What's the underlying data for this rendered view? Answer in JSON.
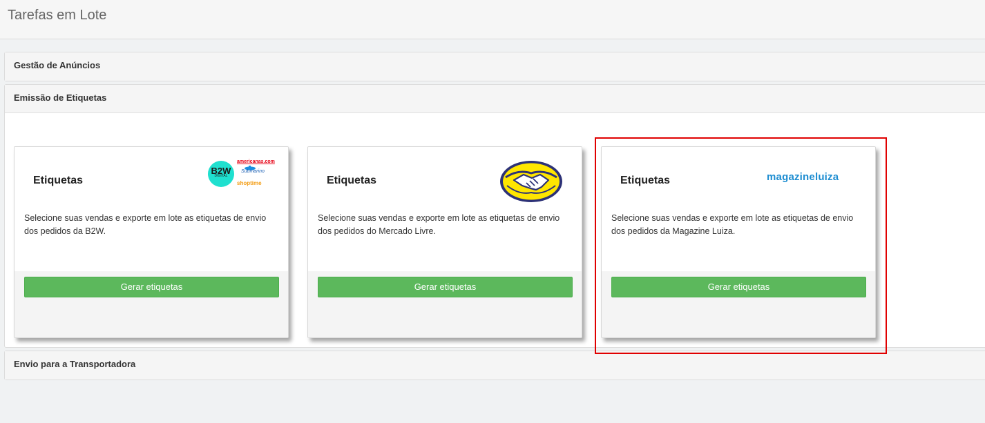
{
  "page": {
    "title": "Tarefas em Lote"
  },
  "panels": {
    "gestao": {
      "heading": "Gestão de Anúncios"
    },
    "emissao": {
      "heading": "Emissão de Etiquetas"
    },
    "envio": {
      "heading": "Envio para a Transportadora"
    }
  },
  "cards": [
    {
      "title": "Etiquetas",
      "description": "Selecione suas vendas e exporte em lote as etiquetas de envio dos pedidos da B2W.",
      "button": "Gerar etiquetas",
      "logo": {
        "name": "b2w-logo",
        "b2w": "B2W",
        "b2w_sub": "DIGITAL",
        "americanas": "americanas.com",
        "submarino": "Submarino",
        "shoptime": "shoptime"
      }
    },
    {
      "title": "Etiquetas",
      "description": "Selecione suas vendas e exporte em lote as etiquetas de envio dos pedidos do Mercado Livre.",
      "button": "Gerar etiquetas",
      "logo": {
        "name": "mercado-livre-handshake-logo"
      }
    },
    {
      "title": "Etiquetas",
      "description": "Selecione suas vendas e exporte em lote as etiquetas de envio dos pedidos da Magazine Luiza.",
      "button": "Gerar etiquetas",
      "logo": {
        "name": "magazine-luiza-logo",
        "text": "magazineluiza"
      }
    }
  ],
  "colors": {
    "button_green": "#5cb85c",
    "highlight_red": "#e00000",
    "b2w_teal": "#1fe0cf",
    "ml_yellow": "#ffe600",
    "ml_blue": "#2d3277",
    "magalu_blue": "#1d8dd1"
  }
}
